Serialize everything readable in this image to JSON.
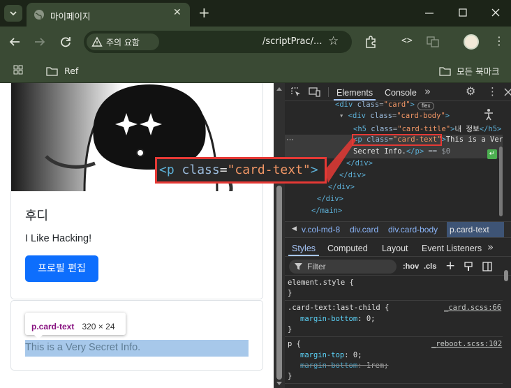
{
  "browser": {
    "tab_title": "마이페이지",
    "security_chip": "주의 요함",
    "url": "/scriptPrac/...",
    "bookmarks": {
      "folder": "Ref",
      "all_bookmarks": "모든 북마크"
    }
  },
  "page": {
    "profile": {
      "name": "후디",
      "bio": "I Like Hacking!",
      "edit_button": "프로필 편집"
    },
    "secret": {
      "text": "This is a Very Secret Info."
    },
    "inspect_tooltip": {
      "selector": "p.card-text",
      "size": "320 × 24"
    }
  },
  "devtools": {
    "tabs": [
      "Elements",
      "Console"
    ],
    "dom": {
      "line1_tag": "div",
      "line1_class": "card",
      "flex_badge": "flex",
      "line2_tag": "div",
      "line2_class": "card-body",
      "h5_class": "card-title",
      "h5_text": "내 정보",
      "p_class": "card-text",
      "p_text_1": "This is a Very",
      "p_text_2": "Secret Info.",
      "dollar0": "== $0",
      "closing": [
        "</div>",
        "</div>",
        "</div>",
        "</div>",
        "</main>"
      ]
    },
    "callout": "<p class=\"card-text\">",
    "breadcrumbs": [
      "v.col-md-8",
      "div.card",
      "div.card-body",
      "p.card-text"
    ],
    "subtabs": [
      "Styles",
      "Computed",
      "Layout",
      "Event Listeners"
    ],
    "filter": {
      "placeholder": "Filter",
      "hov": ":hov",
      "cls": ".cls"
    },
    "rules": [
      {
        "selector": "element.style {",
        "source": "",
        "decls": []
      },
      {
        "selector": ".card-text:last-child {",
        "source": "_card.scss:66",
        "decls": [
          {
            "prop": "margin-bottom",
            "value": "0;"
          }
        ]
      },
      {
        "selector": "p {",
        "source": "_reboot.scss:102",
        "decls": [
          {
            "prop": "margin-top",
            "value": "0;"
          },
          {
            "prop": "margin-bottom",
            "value": "1rem;",
            "struck": true
          }
        ]
      }
    ]
  },
  "colors": {
    "accent_blue": "#0d6efd",
    "highlight": "#e53935",
    "devtools_bg": "#282828"
  }
}
